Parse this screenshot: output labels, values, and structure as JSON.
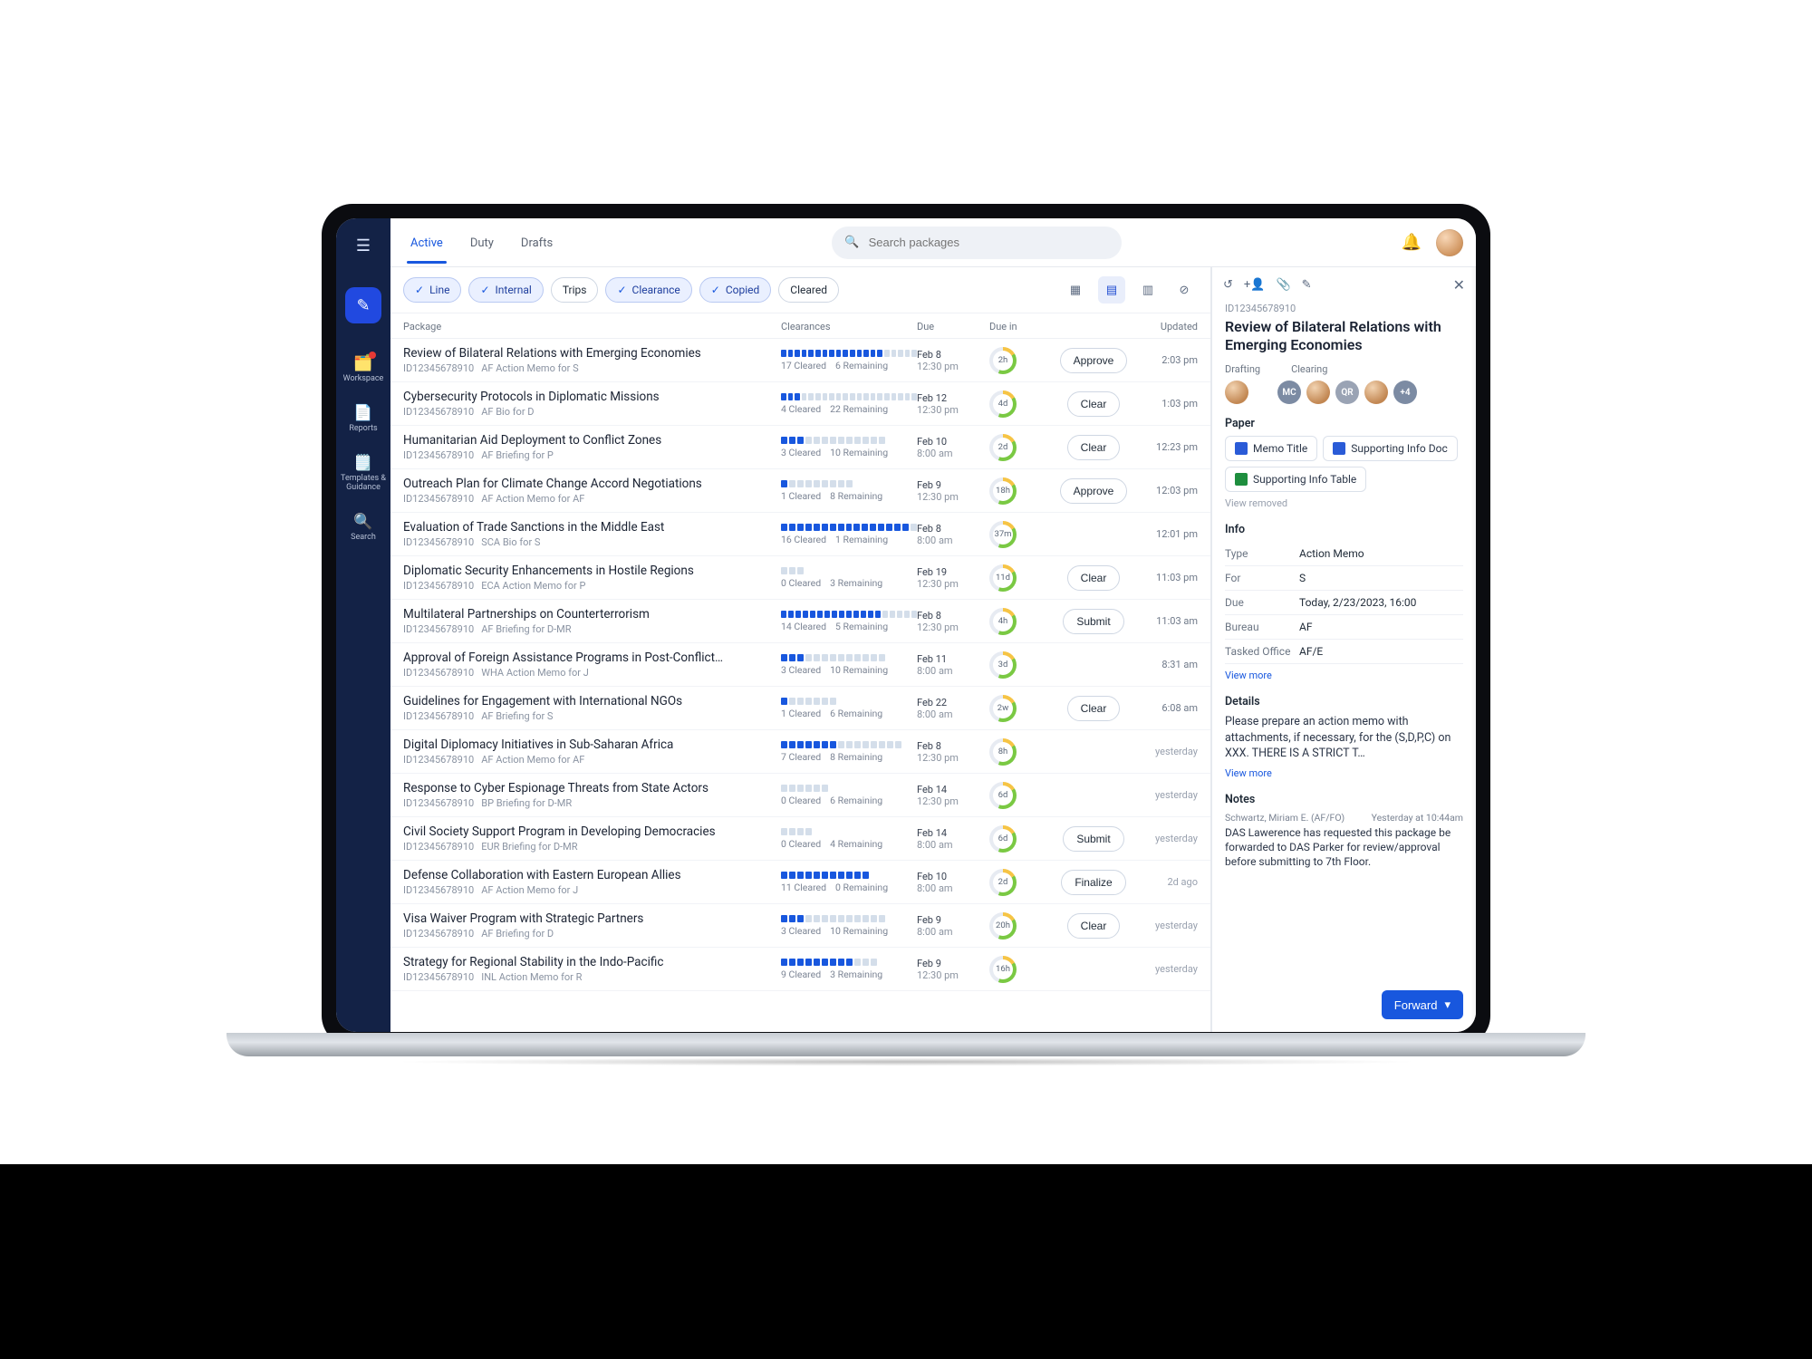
{
  "search": {
    "placeholder": "Search packages"
  },
  "rail": {
    "items": [
      {
        "label": "Workspace"
      },
      {
        "label": "Reports"
      },
      {
        "label": "Templates & Guidance"
      },
      {
        "label": "Search"
      }
    ]
  },
  "tabs": {
    "active": "Active",
    "duty": "Duty",
    "drafts": "Drafts"
  },
  "filters": {
    "chips": [
      {
        "label": "Line",
        "selected": true,
        "check": true
      },
      {
        "label": "Internal",
        "selected": true,
        "check": true
      },
      {
        "label": "Trips",
        "selected": false,
        "check": false
      },
      {
        "label": "Clearance",
        "selected": true,
        "check": true
      },
      {
        "label": "Copied",
        "selected": true,
        "check": true
      },
      {
        "label": "Cleared",
        "selected": false,
        "check": false
      }
    ]
  },
  "columns": {
    "package": "Package",
    "clearances": "Clearances",
    "due": "Due",
    "duein": "Due in",
    "updated": "Updated"
  },
  "rows": [
    {
      "title": "Review of Bilateral Relations with Emerging Economies",
      "id": "ID12345678910",
      "sub": "AF Action Memo for S",
      "cleared": "17 Cleared",
      "remaining": "6 Remaining",
      "total": 23,
      "done": 17,
      "due1": "Feb 8",
      "due2": "12:30 pm",
      "ring": "2h",
      "action": "Approve",
      "updated": "2:03 pm"
    },
    {
      "title": "Cybersecurity Protocols in Diplomatic Missions",
      "id": "ID12345678910",
      "sub": "AF Bio for D",
      "cleared": "4 Cleared",
      "remaining": "22 Remaining",
      "total": 26,
      "done": 4,
      "due1": "Feb 12",
      "due2": "12:30 pm",
      "ring": "4d",
      "action": "Clear",
      "updated": "1:03 pm"
    },
    {
      "title": "Humanitarian Aid Deployment to Conflict Zones",
      "id": "ID12345678910",
      "sub": "AF Briefing for P",
      "cleared": "3 Cleared",
      "remaining": "10 Remaining",
      "total": 13,
      "done": 3,
      "due1": "Feb 10",
      "due2": "8:00 am",
      "ring": "2d",
      "action": "Clear",
      "updated": "12:23 pm"
    },
    {
      "title": "Outreach Plan for Climate Change Accord Negotiations",
      "id": "ID12345678910",
      "sub": "AF Action Memo for AF",
      "cleared": "1 Cleared",
      "remaining": "8 Remaining",
      "total": 9,
      "done": 1,
      "due1": "Feb 9",
      "due2": "12:30 pm",
      "ring": "18h",
      "action": "Approve",
      "updated": "12:03 pm"
    },
    {
      "title": "Evaluation of Trade Sanctions in the Middle East",
      "id": "ID12345678910",
      "sub": "SCA Bio for S",
      "cleared": "16 Cleared",
      "remaining": "1 Remaining",
      "total": 17,
      "done": 16,
      "due1": "Feb 8",
      "due2": "8:00 am",
      "ring": "37m",
      "action": "",
      "updated": "12:01 pm"
    },
    {
      "title": "Diplomatic Security Enhancements in Hostile Regions",
      "id": "ID12345678910",
      "sub": "ECA Action Memo for P",
      "cleared": "0 Cleared",
      "remaining": "3 Remaining",
      "total": 3,
      "done": 0,
      "due1": "Feb 19",
      "due2": "12:30 pm",
      "ring": "11d",
      "action": "Clear",
      "updated": "11:03 pm"
    },
    {
      "title": "Multilateral Partnerships on Counterterrorism",
      "id": "ID12345678910",
      "sub": "AF Briefing for D-MR",
      "cleared": "14 Cleared",
      "remaining": "5 Remaining",
      "total": 19,
      "done": 14,
      "due1": "Feb 8",
      "due2": "12:30 pm",
      "ring": "4h",
      "action": "Submit",
      "updated": "11:03 am"
    },
    {
      "title": "Approval of Foreign Assistance Programs in Post-Conflict…",
      "id": "ID12345678910",
      "sub": "WHA Action Memo for J",
      "cleared": "3 Cleared",
      "remaining": "10 Remaining",
      "total": 13,
      "done": 3,
      "due1": "Feb 11",
      "due2": "8:00 am",
      "ring": "3d",
      "action": "",
      "updated": "8:31 am"
    },
    {
      "title": "Guidelines for Engagement with International NGOs",
      "id": "ID12345678910",
      "sub": "AF Briefing for S",
      "cleared": "1 Cleared",
      "remaining": "6 Remaining",
      "total": 7,
      "done": 1,
      "due1": "Feb 22",
      "due2": "8:00 am",
      "ring": "2w",
      "action": "Clear",
      "updated": "6:08 am"
    },
    {
      "title": "Digital Diplomacy Initiatives in Sub-Saharan Africa",
      "id": "ID12345678910",
      "sub": "AF Action Memo for AF",
      "cleared": "7 Cleared",
      "remaining": "8 Remaining",
      "total": 15,
      "done": 7,
      "due1": "Feb 8",
      "due2": "12:30 pm",
      "ring": "8h",
      "action": "",
      "updated": "yesterday"
    },
    {
      "title": "Response to Cyber Espionage Threats from State Actors",
      "id": "ID12345678910",
      "sub": "BP Briefing for D-MR",
      "cleared": "0 Cleared",
      "remaining": "6 Remaining",
      "total": 6,
      "done": 0,
      "due1": "Feb 14",
      "due2": "12:30 pm",
      "ring": "6d",
      "action": "",
      "updated": "yesterday"
    },
    {
      "title": "Civil Society Support Program in Developing Democracies",
      "id": "ID12345678910",
      "sub": "EUR Briefing for D-MR",
      "cleared": "0 Cleared",
      "remaining": "4 Remaining",
      "total": 4,
      "done": 0,
      "due1": "Feb 14",
      "due2": "8:00 am",
      "ring": "6d",
      "action": "Submit",
      "updated": "yesterday"
    },
    {
      "title": "Defense Collaboration with Eastern European Allies",
      "id": "ID12345678910",
      "sub": "AF Action Memo for J",
      "cleared": "11 Cleared",
      "remaining": "0 Remaining",
      "total": 11,
      "done": 11,
      "due1": "Feb 10",
      "due2": "8:00 am",
      "ring": "2d",
      "action": "Finalize",
      "updated": "2d ago"
    },
    {
      "title": "Visa Waiver Program with Strategic Partners",
      "id": "ID12345678910",
      "sub": "AF Briefing for D",
      "cleared": "3 Cleared",
      "remaining": "10 Remaining",
      "total": 13,
      "done": 3,
      "due1": "Feb 9",
      "due2": "8:00 am",
      "ring": "20h",
      "action": "Clear",
      "updated": "yesterday"
    },
    {
      "title": "Strategy for Regional Stability in the Indo-Pacific",
      "id": "ID12345678910",
      "sub": "INL Action Memo for R",
      "cleared": "9 Cleared",
      "remaining": "3 Remaining",
      "total": 12,
      "done": 9,
      "due1": "Feb 9",
      "due2": "12:30 pm",
      "ring": "16h",
      "action": "",
      "updated": "yesterday"
    }
  ],
  "side": {
    "id": "ID12345678910",
    "title": "Review of Bilateral Relations with Emerging Economies",
    "drafting_h": "Drafting",
    "clearing_h": "Clearing",
    "clearing_avatars": [
      "MC",
      "",
      "QR",
      "",
      "+4"
    ],
    "paper_h": "Paper",
    "paper": [
      {
        "kind": "doc",
        "label": "Memo Title"
      },
      {
        "kind": "doc",
        "label": "Supporting Info Doc"
      },
      {
        "kind": "xls",
        "label": "Supporting Info Table"
      }
    ],
    "view_removed": "View removed",
    "info_h": "Info",
    "info": [
      {
        "k": "Type",
        "v": "Action Memo"
      },
      {
        "k": "For",
        "v": "S"
      },
      {
        "k": "Due",
        "v": "Today, 2/23/2023, 16:00"
      },
      {
        "k": "Bureau",
        "v": "AF"
      },
      {
        "k": "Tasked Office",
        "v": "AF/E"
      }
    ],
    "view_more1": "View more",
    "details_h": "Details",
    "details": "Please prepare an action memo with attachments, if necessary, for the (S,D,P,C) on XXX. THERE IS A STRICT T…",
    "view_more2": "View more",
    "notes_h": "Notes",
    "note_author": "Schwartz, Miriam E. (AF/FO)",
    "note_time": "Yesterday at 10:44am",
    "note_body": "DAS Lawerence has requested this package be forwarded to DAS Parker for review/approval before submitting to 7th Floor.",
    "forward": "Forward"
  }
}
